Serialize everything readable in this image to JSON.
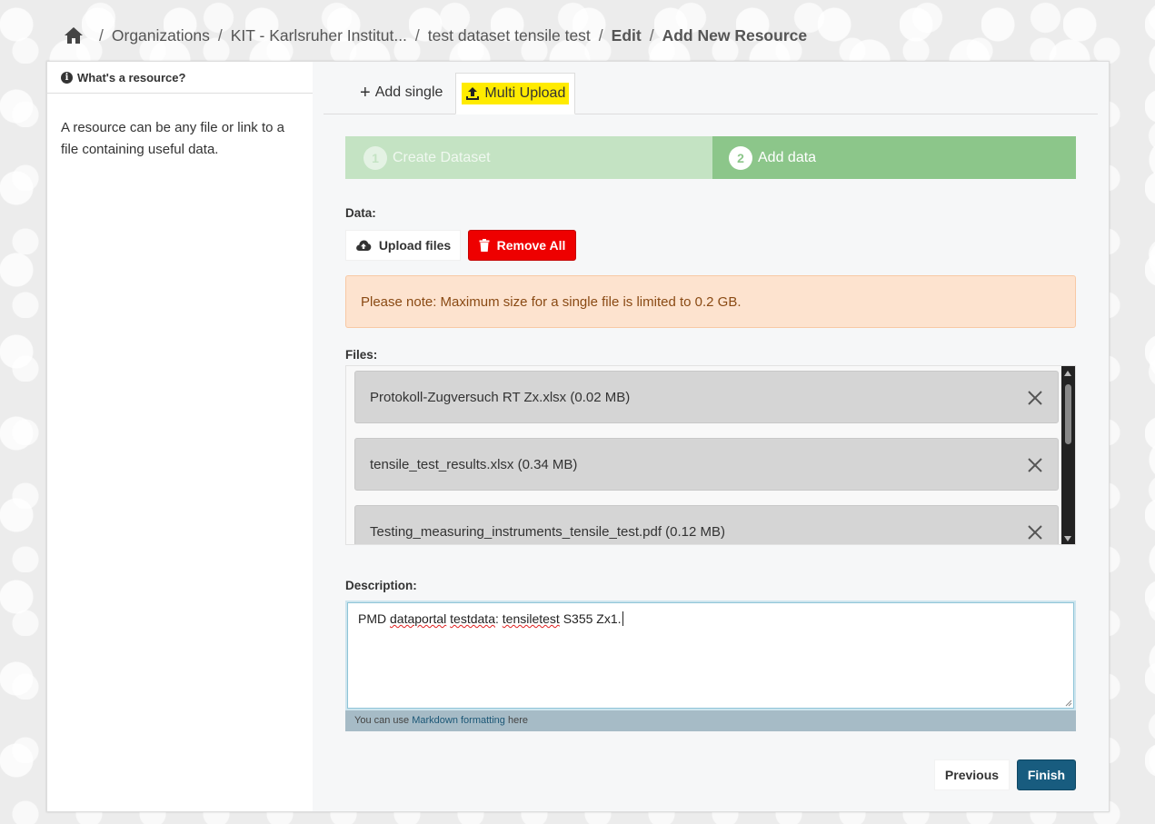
{
  "breadcrumb": {
    "home_icon": "home-icon",
    "items": [
      "Organizations",
      "KIT - Karlsruher Institut...",
      "test dataset tensile test",
      "Edit",
      "Add New Resource"
    ]
  },
  "aside": {
    "heading": "What's a resource?",
    "info_icon": "info-icon",
    "text": "A resource can be any file or link to a file containing useful data."
  },
  "tabs": {
    "add_single": "Add single",
    "multi_upload": "Multi Upload"
  },
  "stages": [
    {
      "number": "1",
      "label": "Create Dataset"
    },
    {
      "number": "2",
      "label": "Add data"
    }
  ],
  "data_section": {
    "label": "Data:",
    "upload_label": "Upload files",
    "remove_all_label": "Remove All",
    "notice": "Please note: Maximum size for a single file is limited to 0.2 GB."
  },
  "files": {
    "label": "Files:",
    "items": [
      "Protokoll-Zugversuch RT Zx.xlsx (0.02 MB)",
      "tensile_test_results.xlsx (0.34 MB)",
      "Testing_measuring_instruments_tensile_test.pdf (0.12 MB)"
    ]
  },
  "description": {
    "label": "Description:",
    "value_parts": [
      "PMD ",
      "dataportal",
      " ",
      "testdata",
      ": ",
      "tensiletest",
      " S355 Zx1."
    ],
    "hint_prefix": "You can use ",
    "hint_link": "Markdown formatting",
    "hint_suffix": " here"
  },
  "actions": {
    "previous": "Previous",
    "finish": "Finish"
  },
  "colors": {
    "stage_active": "#8cc68a",
    "stage_done": "#c4e3c3",
    "remove": "#ee0000",
    "finish": "#185c7f",
    "highlight": "#ffeb00"
  }
}
